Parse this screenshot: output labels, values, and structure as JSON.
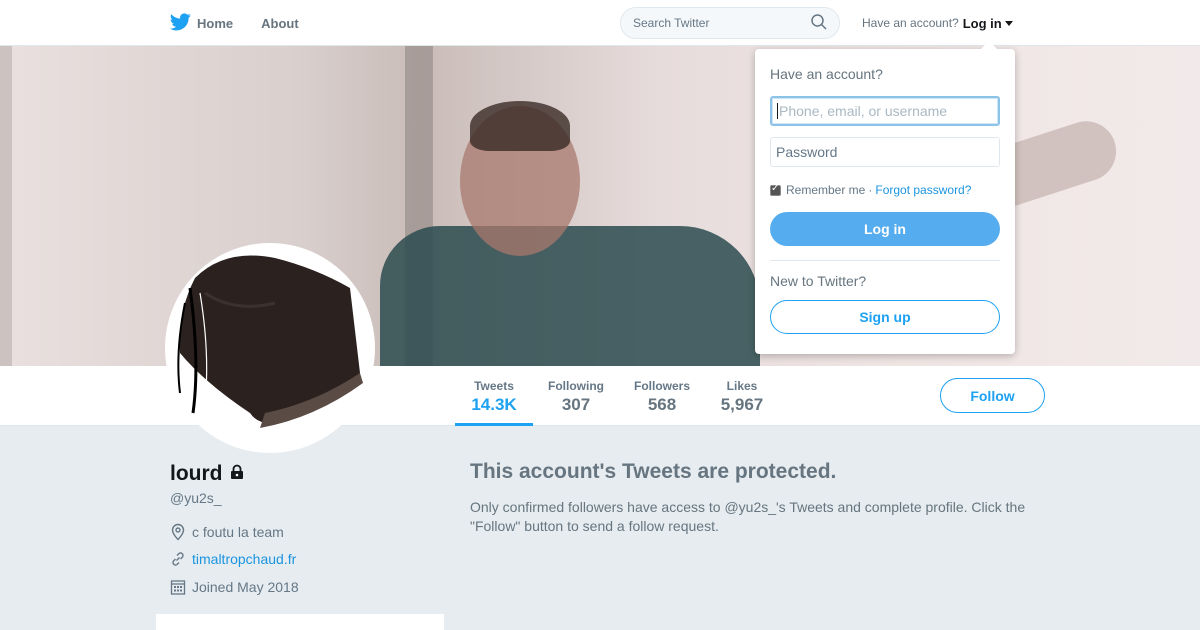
{
  "nav": {
    "home_label": "Home",
    "about_label": "About",
    "search_placeholder": "Search Twitter",
    "have_account": "Have an account?",
    "login_label": "Log in"
  },
  "profile": {
    "name": "lourd",
    "handle": "@yu2s_",
    "location": "c foutu la team",
    "website": "timaltropchaud.fr",
    "joined": "Joined May 2018"
  },
  "stats": [
    {
      "label": "Tweets",
      "value": "14.3K"
    },
    {
      "label": "Following",
      "value": "307"
    },
    {
      "label": "Followers",
      "value": "568"
    },
    {
      "label": "Likes",
      "value": "5,967"
    }
  ],
  "follow_label": "Follow",
  "protected": {
    "title": "This account's Tweets are protected.",
    "text": "Only confirmed followers have access to @yu2s_'s Tweets and complete profile. Click the \"Follow\" button to send a follow request."
  },
  "login_dropdown": {
    "title": "Have an account?",
    "username_placeholder": "Phone, email, or username",
    "password_placeholder": "Password",
    "remember_label": "Remember me",
    "separator": "·",
    "forgot_label": "Forgot password?",
    "login_button": "Log in",
    "new_label": "New to Twitter?",
    "signup_button": "Sign up"
  },
  "colors": {
    "accent": "#1da1f2",
    "login_button": "#55acee",
    "background": "#e6ecf0"
  },
  "icons": [
    "twitter-bird-icon",
    "search-icon",
    "caret-down-icon",
    "lock-icon",
    "location-icon",
    "link-icon",
    "calendar-icon"
  ]
}
